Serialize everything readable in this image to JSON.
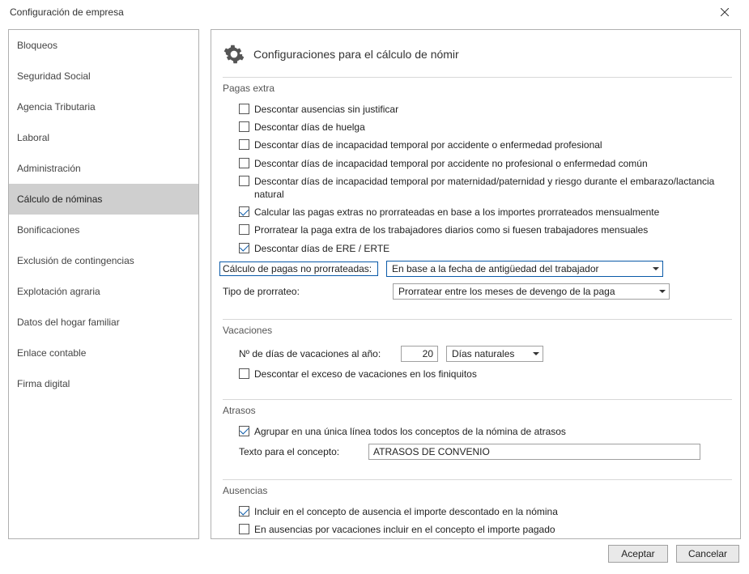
{
  "window": {
    "title": "Configuración de empresa"
  },
  "sidebar": {
    "items": [
      {
        "label": "Bloqueos"
      },
      {
        "label": "Seguridad Social"
      },
      {
        "label": "Agencia Tributaria"
      },
      {
        "label": "Laboral"
      },
      {
        "label": "Administración"
      },
      {
        "label": "Cálculo de nóminas",
        "selected": true
      },
      {
        "label": "Bonificaciones"
      },
      {
        "label": "Exclusión de contingencias"
      },
      {
        "label": "Explotación agraria"
      },
      {
        "label": "Datos del hogar familiar"
      },
      {
        "label": "Enlace contable"
      },
      {
        "label": "Firma digital"
      }
    ]
  },
  "page": {
    "title": "Configuraciones para el cálculo de nómir"
  },
  "sections": {
    "pagas_extra": {
      "title": "Pagas extra",
      "checks": [
        {
          "label": "Descontar ausencias sin justificar",
          "checked": false
        },
        {
          "label": "Descontar días de huelga",
          "checked": false
        },
        {
          "label": "Descontar días de incapacidad temporal por accidente o enfermedad profesional",
          "checked": false
        },
        {
          "label": "Descontar días de incapacidad temporal por accidente no profesional o enfermedad común",
          "checked": false
        },
        {
          "label": "Descontar días de incapacidad temporal por maternidad/paternidad y riesgo durante el embarazo/lactancia natural",
          "checked": false
        },
        {
          "label": "Calcular las pagas extras no prorrateadas en base a los importes prorrateados mensualmente",
          "checked": true
        },
        {
          "label": "Prorratear la paga extra de los trabajadores diarios como si fuesen trabajadores mensuales",
          "checked": false
        },
        {
          "label": "Descontar días de ERE / ERTE",
          "checked": true
        }
      ],
      "calc_label": "Cálculo de pagas no prorrateadas:",
      "calc_value": "En base a la fecha de antigüedad del trabajador",
      "tipo_label": "Tipo de prorrateo:",
      "tipo_value": "Prorratear entre los meses de devengo de la paga"
    },
    "vacaciones": {
      "title": "Vacaciones",
      "dias_label": "Nº de días de vacaciones al año:",
      "dias_value": "20",
      "dias_tipo": "Días naturales",
      "exceso": {
        "label": "Descontar el exceso de vacaciones en los finiquitos",
        "checked": false
      }
    },
    "atrasos": {
      "title": "Atrasos",
      "agrupar": {
        "label": "Agrupar en una única línea todos los conceptos de la nómina de atrasos",
        "checked": true
      },
      "texto_label": "Texto para el concepto:",
      "texto_value": "ATRASOS DE CONVENIO"
    },
    "ausencias": {
      "title": "Ausencias",
      "incluir": {
        "label": "Incluir en el concepto de ausencia el importe descontado en la nómina",
        "checked": true
      },
      "vac": {
        "label": "En ausencias por vacaciones incluir en el concepto el importe pagado",
        "checked": false
      }
    }
  },
  "buttons": {
    "accept": "Aceptar",
    "cancel": "Cancelar"
  }
}
